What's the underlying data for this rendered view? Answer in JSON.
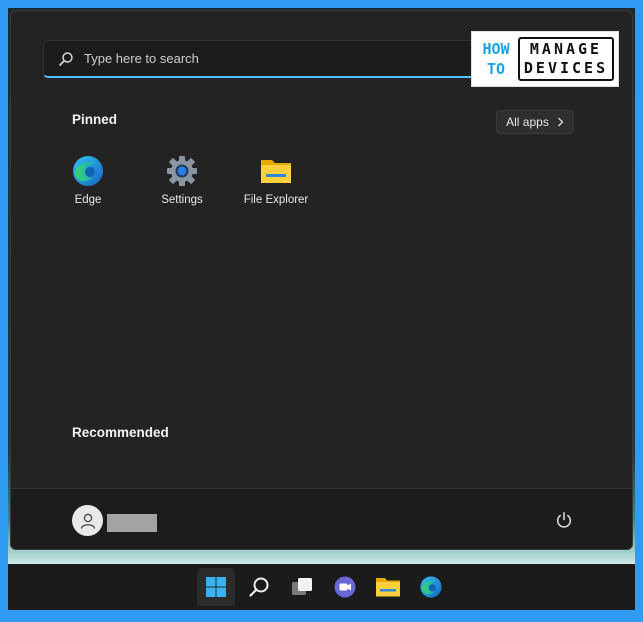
{
  "search": {
    "placeholder": "Type here to search"
  },
  "logo": {
    "left_top": "HOW",
    "left_bottom": "TO",
    "right_top": "MANAGE",
    "right_bottom": "DEVICES"
  },
  "pinned": {
    "title": "Pinned",
    "all_apps_label": "All apps",
    "apps": [
      {
        "label": "Edge",
        "icon": "edge-icon"
      },
      {
        "label": "Settings",
        "icon": "settings-icon"
      },
      {
        "label": "File Explorer",
        "icon": "file-explorer-icon"
      }
    ]
  },
  "recommended": {
    "title": "Recommended"
  },
  "footer": {
    "user_icon": "user-avatar-icon",
    "power_icon": "power-icon"
  },
  "taskbar": {
    "items": [
      {
        "icon": "windows-start-icon",
        "active": true
      },
      {
        "icon": "search-icon"
      },
      {
        "icon": "task-view-icon"
      },
      {
        "icon": "teams-chat-icon"
      },
      {
        "icon": "file-explorer-icon"
      },
      {
        "icon": "edge-icon"
      }
    ]
  },
  "colors": {
    "accent": "#4cc2ff",
    "menu_bg": "#232323",
    "frame": "#2f9bf2"
  }
}
